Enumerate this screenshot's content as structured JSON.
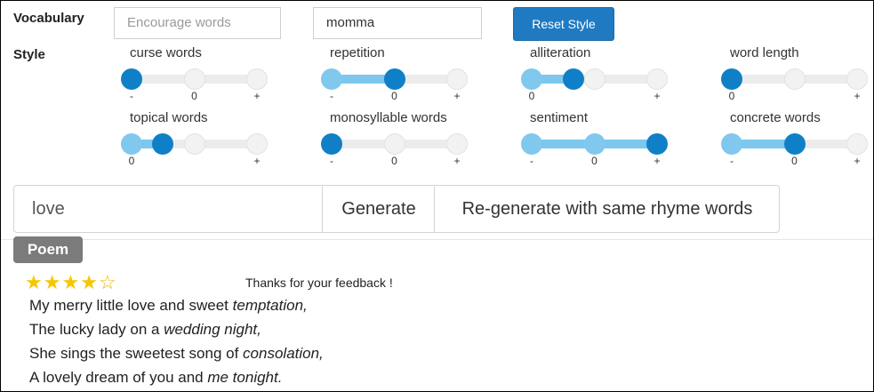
{
  "vocabulary": {
    "label": "Vocabulary",
    "encourage_placeholder": "Encourage words",
    "banned_value": "momma",
    "reset_label": "Reset Style"
  },
  "style": {
    "label": "Style",
    "sliders": [
      {
        "title": "curse words",
        "ticks": [
          "-",
          "0",
          "+"
        ],
        "knobs": [
          0.0
        ],
        "fill": null,
        "filled_knob": 0.0
      },
      {
        "title": "repetition",
        "ticks": [
          "-",
          "0",
          "+"
        ],
        "knobs": [
          0.5
        ],
        "fill": [
          0.0,
          0.5
        ],
        "filled_knob": 0.5
      },
      {
        "title": "alliteration",
        "ticks": [
          "0",
          "",
          "+"
        ],
        "knobs": [
          0.33
        ],
        "fill": [
          0.0,
          0.33
        ],
        "filled_knob": 0.33
      },
      {
        "title": "word length",
        "ticks": [
          "0",
          "",
          "+"
        ],
        "knobs": [
          0.0
        ],
        "fill": null,
        "filled_knob": 0.0
      },
      {
        "title": "topical words",
        "ticks": [
          "0",
          "",
          "+"
        ],
        "knobs": [
          0.25
        ],
        "fill": [
          0.0,
          0.25
        ],
        "filled_knob": 0.25
      },
      {
        "title": "monosyllable words",
        "ticks": [
          "-",
          "0",
          "+"
        ],
        "knobs": [
          0.0
        ],
        "fill": null,
        "filled_knob": 0.0
      },
      {
        "title": "sentiment",
        "ticks": [
          "-",
          "0",
          "+"
        ],
        "knobs": [
          1.0
        ],
        "fill": [
          0.0,
          1.0
        ],
        "filled_knob": 1.0
      },
      {
        "title": "concrete words",
        "ticks": [
          "-",
          "0",
          "+"
        ],
        "knobs": [
          0.5
        ],
        "fill": [
          0.0,
          0.5
        ],
        "filled_knob": 0.5
      }
    ]
  },
  "generate": {
    "seed_value": "love",
    "generate_label": "Generate",
    "regenerate_label": "Re-generate with same rhyme words"
  },
  "poem": {
    "badge": "Poem",
    "rating": 4,
    "rating_max": 5,
    "feedback": "Thanks for your feedback !",
    "lines": [
      {
        "text": "My merry little love and sweet ",
        "rhyme": "temptation,"
      },
      {
        "text": "The lucky lady on a ",
        "rhyme": "wedding night,"
      },
      {
        "text": "She sings the sweetest song of ",
        "rhyme": "consolation,"
      },
      {
        "text": "A lovely dream of you and ",
        "rhyme": "me tonight."
      }
    ]
  },
  "colors": {
    "accent": "#1f7ac2",
    "slider_fill": "#7cc7ee",
    "star": "#f7c600",
    "badge": "#7b7b7b"
  }
}
